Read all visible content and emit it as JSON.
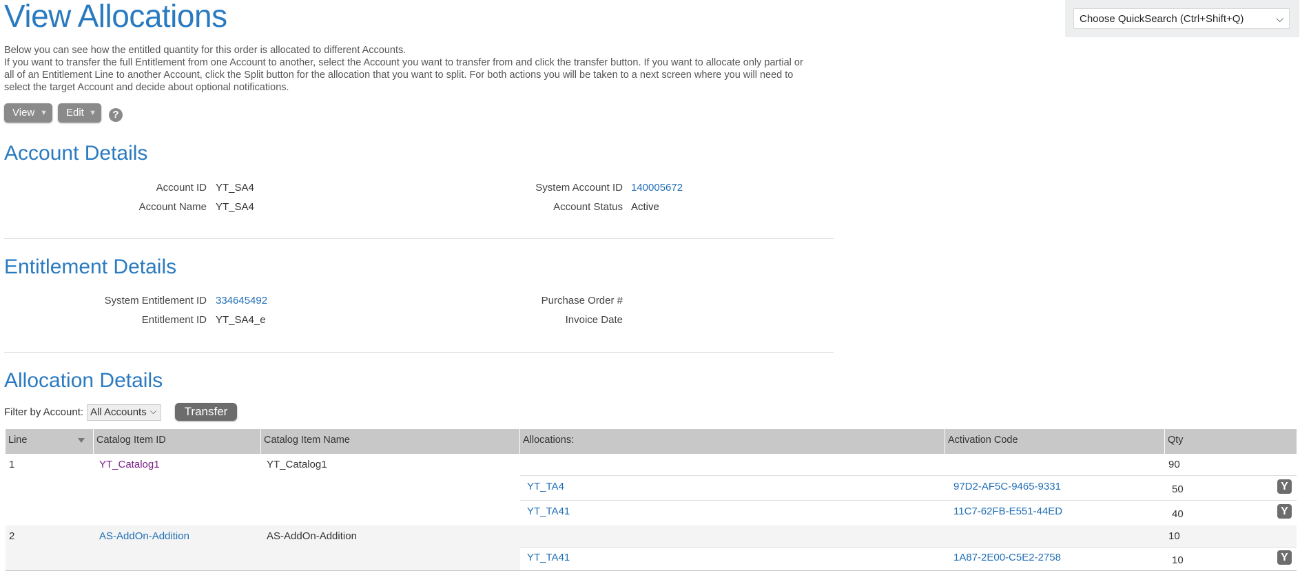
{
  "page": {
    "title": "View Allocations",
    "intro": [
      "Below you can see how the entitled quantity for this order is allocated to different Accounts.",
      "If you want to transfer the full Entitlement from one Account to another, select the Account you want to transfer from and click the transfer button. If you want to allocate only partial or all of an Entitlement Line to another Account, click the Split button for the allocation that you want to split. For both actions you will be taken to a next screen where you will need to select the target Account and decide about optional notifications."
    ]
  },
  "quicksearch": {
    "label": "Choose QuickSearch (Ctrl+Shift+Q)"
  },
  "toolbar": {
    "view_label": "View",
    "edit_label": "Edit",
    "help_symbol": "?"
  },
  "account_details": {
    "title": "Account Details",
    "account_id_label": "Account ID",
    "account_id": "YT_SA4",
    "account_name_label": "Account Name",
    "account_name": "YT_SA4",
    "system_account_id_label": "System Account ID",
    "system_account_id": "140005672",
    "account_status_label": "Account Status",
    "account_status": "Active"
  },
  "entitlement_details": {
    "title": "Entitlement Details",
    "system_entitlement_id_label": "System Entitlement ID",
    "system_entitlement_id": "334645492",
    "entitlement_id_label": "Entitlement ID",
    "entitlement_id": "YT_SA4_e",
    "purchase_order_label": "Purchase Order #",
    "purchase_order": "",
    "invoice_date_label": "Invoice Date",
    "invoice_date": ""
  },
  "allocation_details": {
    "title": "Allocation Details",
    "filter_label": "Filter by Account:",
    "filter_value": "All Accounts",
    "transfer_label": "Transfer",
    "columns": [
      "Line",
      "Catalog Item ID",
      "Catalog Item Name",
      "Allocations:",
      "Activation Code",
      "Qty"
    ],
    "rows": [
      {
        "line": "1",
        "catalog_item_id": "YT_Catalog1",
        "catalog_item_name": "YT_Catalog1",
        "qty": "90",
        "allocations": [
          {
            "account": "YT_TA4",
            "activation_code": "97D2-AF5C-9465-9331",
            "qty": "50"
          },
          {
            "account": "YT_TA41",
            "activation_code": "11C7-62FB-E551-44ED",
            "qty": "40"
          }
        ]
      },
      {
        "line": "2",
        "catalog_item_id": "AS-AddOn-Addition",
        "catalog_item_name": "AS-AddOn-Addition",
        "qty": "10",
        "allocations": [
          {
            "account": "YT_TA41",
            "activation_code": "1A87-2E00-C5E2-2758",
            "qty": "10"
          }
        ]
      }
    ]
  },
  "colors": {
    "heading": "#2a7ac0",
    "link": "#1f6eb5",
    "visited_link": "#7a1f8a",
    "header_bg": "#c8c8c8"
  }
}
